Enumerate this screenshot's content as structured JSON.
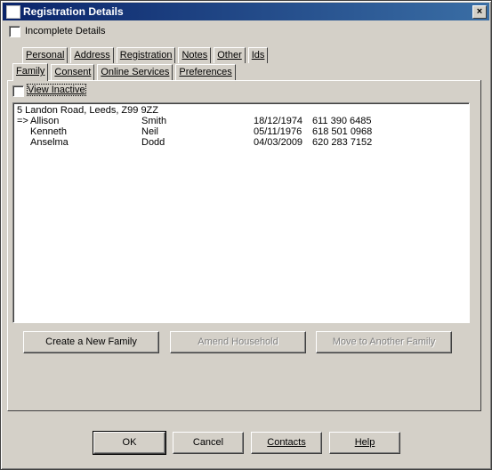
{
  "window": {
    "title": "Registration Details",
    "close": "×"
  },
  "incomplete_details": {
    "label": "Incomplete Details",
    "checked": false
  },
  "tabs_top": [
    {
      "label": "Personal"
    },
    {
      "label": "Address"
    },
    {
      "label": "Registration"
    },
    {
      "label": "Notes"
    },
    {
      "label": "Other"
    },
    {
      "label": "Ids"
    }
  ],
  "tabs_bottom": [
    {
      "label": "Family"
    },
    {
      "label": "Consent"
    },
    {
      "label": "Online Services"
    },
    {
      "label": "Preferences"
    }
  ],
  "view_inactive": {
    "label": "View Inactive",
    "checked": false
  },
  "family_list": {
    "address": "5 Landon Road, Leeds, Z99 9ZZ",
    "rows": [
      {
        "marker": "=>",
        "first": "Allison",
        "last": "Smith",
        "dob": "18/12/1974",
        "nhs": "611 390 6485"
      },
      {
        "marker": "",
        "first": "Kenneth",
        "last": "Neil",
        "dob": "05/11/1976",
        "nhs": "618 501 0968"
      },
      {
        "marker": "",
        "first": "Anselma",
        "last": "Dodd",
        "dob": "04/03/2009",
        "nhs": "620 283 7152"
      }
    ]
  },
  "actions": {
    "create_family": "Create a New Family",
    "amend_household": "Amend Household",
    "move_family": "Move to Another Family"
  },
  "footer": {
    "ok": "OK",
    "cancel": "Cancel",
    "contacts": "Contacts",
    "help": "Help"
  }
}
